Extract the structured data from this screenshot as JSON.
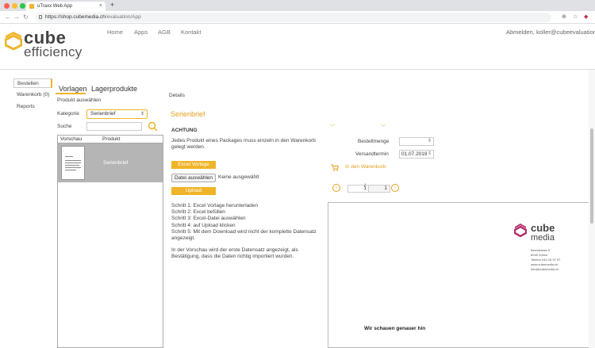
{
  "browser": {
    "tab_title": "uTraxx Web App",
    "new_tab": "+",
    "close_tab": "×",
    "url_host": "https://shop.cubemedia.ch",
    "url_path": "/evaluation/App"
  },
  "header": {
    "logo_line1": "cube",
    "logo_line2": "efficiency",
    "nav": [
      "Home",
      "Apps",
      "AGB",
      "Kontakt"
    ],
    "user_links": "Abmelden, koller@cubeevaluation.c"
  },
  "sidebar": {
    "items": [
      {
        "label": "Bestellen",
        "active": true
      },
      {
        "label": "Warenkorb (0)",
        "active": false
      },
      {
        "label": "Reports",
        "active": false
      }
    ]
  },
  "tabs": [
    {
      "label": "Vorlagen",
      "active": true
    },
    {
      "label": "Lagerprodukte",
      "active": false
    }
  ],
  "products": {
    "section_label": "Produkt auswählen",
    "category_label": "Kategorie",
    "category_value": "Serienbrief",
    "search_label": "Suche",
    "search_value": "",
    "columns": [
      "Vorschau",
      "Produkt"
    ],
    "rows": [
      {
        "name": "Serienbrief"
      }
    ]
  },
  "details": {
    "label": "Details",
    "title": "Serienbrief",
    "warning_title": "ACHTUNG",
    "warning_text_1": "Jedes Produkt eines Packages muss einzeln in den Warenkorb",
    "warning_text_2": "gelegt werden.",
    "excel_button": "Excel Vorlage",
    "file_button": "Datei auswählen",
    "file_status": "Keine ausgewählt",
    "upload_button": "Upload",
    "steps": [
      "Schritt 1: Excel Vorlage herunterladen",
      "Schritt 2: Excel befüllen",
      "Schritt 3: Excel-Datei auswählen",
      "Schritt 4: auf Upload klicken",
      "Schritt 5: Mit dem Download wird nicht der komplette Datensatz",
      "angezeigt."
    ],
    "note_1": "In der Vorschau wird der erste Datensatz angezeigt, als",
    "note_2": "Bestätigung, dass die Daten richtig importiert wurden."
  },
  "order": {
    "quantity_label": "Bestellmenge",
    "quantity_value": "",
    "date_label": "Versandtermin",
    "date_value": "01.07.2019",
    "cart_button": "In den Warenkorb",
    "page_current": "1",
    "page_sep": "/",
    "page_total": "1"
  },
  "preview": {
    "logo_cube": "cube",
    "logo_media": "media",
    "address": [
      "Binzstrasse 9",
      "8045 Zürich",
      "Telefon 044 20 97 97",
      "www.cubemedia.ch",
      "info@cubemedia.ch"
    ],
    "body_text": "Wir schauen genauer hin"
  },
  "colors": {
    "accent": "#f0b429",
    "accent_text": "#e0a020",
    "logo_magenta": "#b5316b"
  }
}
